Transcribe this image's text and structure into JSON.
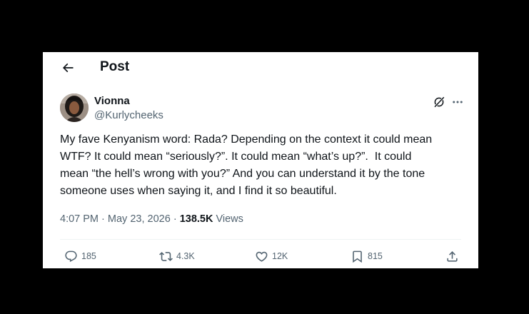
{
  "header": {
    "title": "Post"
  },
  "author": {
    "display_name": "Vionna",
    "handle": "@Kurlycheeks"
  },
  "tweet": {
    "text": "My fave Kenyanism word: Rada? Depending on the context it could mean\nWTF? It could mean “seriously?”. It could mean “what’s up?”.  It could\nmean “the hell’s wrong with you?” And you can understand it by the tone\nsomeone uses when saying it, and I find it so beautiful."
  },
  "meta": {
    "time": "4:07 PM",
    "separator": "·",
    "date": "May 23, 2026",
    "views_count": "138.5K",
    "views_label": "Views"
  },
  "actions": {
    "replies": "185",
    "reposts": "4.3K",
    "likes": "12K",
    "bookmarks": "815"
  },
  "icons": {
    "back": "arrow-left-icon",
    "grok": "grok-icon",
    "more": "more-horizontal-icon",
    "reply": "reply-icon",
    "repost": "repost-icon",
    "like": "heart-icon",
    "bookmark": "bookmark-icon",
    "share": "share-icon"
  },
  "colors": {
    "text": "#0f1419",
    "secondary": "#536471",
    "divider": "#eff3f4",
    "frame": "#000000",
    "card": "#ffffff"
  }
}
